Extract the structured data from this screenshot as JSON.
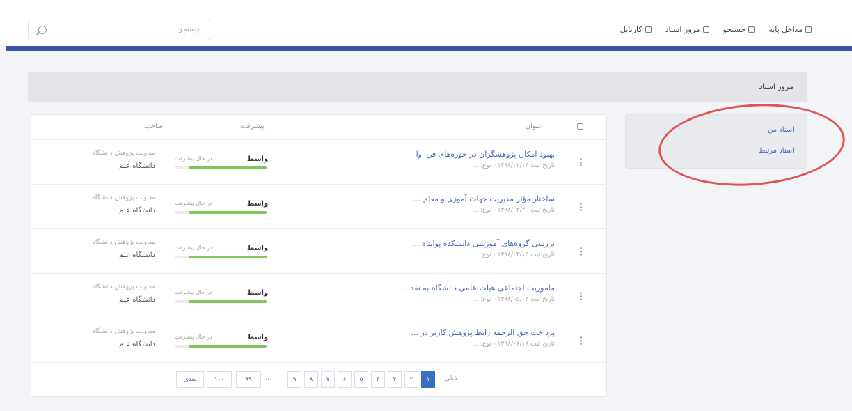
{
  "topbar": {
    "search_placeholder": "جستجو",
    "nav": [
      {
        "label": "کارتابل",
        "icon": "grid-icon"
      },
      {
        "label": "مرور اسناد",
        "icon": "document-icon"
      },
      {
        "label": "جستجو",
        "icon": "search-icon"
      },
      {
        "label": "مداخل پایه",
        "icon": "database-icon"
      }
    ]
  },
  "page": {
    "title": "مرور اسناد"
  },
  "sidebar": {
    "items": [
      {
        "label": "اسناد من"
      },
      {
        "label": "اسناد مرتبط"
      }
    ]
  },
  "table": {
    "headers": {
      "title": "عنوان",
      "progress": "پیشرفت",
      "author": "صاحب"
    },
    "rows": [
      {
        "title": "بهبود امکان پژوهشگران در حوزه‌های فن آوا",
        "subtitle": "تاریخ ثبت ۱۳۹۸/۰۲/۱۴ - نوع: ...",
        "status": "واسط",
        "progress_label": "در حال پیشرفت",
        "progress": 0.85,
        "author_line1": "معاونت پژوهش دانشگاه",
        "author_line2": "دانشگاه علم"
      },
      {
        "title": "ساختار مؤثر مدیریت جهات آموزی و معلم ...",
        "subtitle": "تاریخ ثبت ۱۳۹۸/۰۳/۲۰ - نوع: ...",
        "status": "واسط",
        "progress_label": "در حال پیشرفت",
        "progress": 0.85,
        "author_line1": "معاونت پژوهش دانشگاه",
        "author_line2": "دانشگاه علم"
      },
      {
        "title": "بررسی گروه‌های آموزشی دانشکده پوانتاه ...",
        "subtitle": "تاریخ ثبت ۱۳۹۸/۰۴/۱۵ - نوع: ...",
        "status": "واسط",
        "progress_label": "در حال پیشرفت",
        "progress": 0.85,
        "author_line1": "معاونت پژوهش دانشگاه",
        "author_line2": "دانشگاه علم"
      },
      {
        "title": "ماموریت اجتماعی هیات علمی دانشگاه به نقد ...",
        "subtitle": "تاریخ ثبت ۱۳۹۸/۰۵/۰۳ - نوع: ...",
        "status": "واسط",
        "progress_label": "در حال پیشرفت",
        "progress": 0.85,
        "author_line1": "معاونت پژوهش دانشگاه",
        "author_line2": "دانشگاه علم"
      },
      {
        "title": "پرداخت حق الزحمه رابط پژوهش کاربر در ...",
        "subtitle": "تاریخ ثبت ۱۳۹۸/۰۶/۱۸ - نوع: ...",
        "status": "واسط",
        "progress_label": "در حال پیشرفت",
        "progress": 0.85,
        "author_line1": "معاونت پژوهش دانشگاه",
        "author_line2": "دانشگاه علم"
      }
    ]
  },
  "pagination": {
    "label": "قبلی",
    "pages": [
      "۱",
      "۲",
      "۳",
      "۴",
      "۵",
      "۶",
      "۷",
      "۸",
      "۹"
    ],
    "active_page": "۱",
    "ellipsis": "...",
    "tail": [
      "۹۹",
      "۱۰۰"
    ],
    "next_label": "بعدی"
  },
  "colors": {
    "accent_bar": "#3a54a6",
    "link": "#4a66b8",
    "progress": "#7fc75a",
    "highlight": "#e05355"
  }
}
